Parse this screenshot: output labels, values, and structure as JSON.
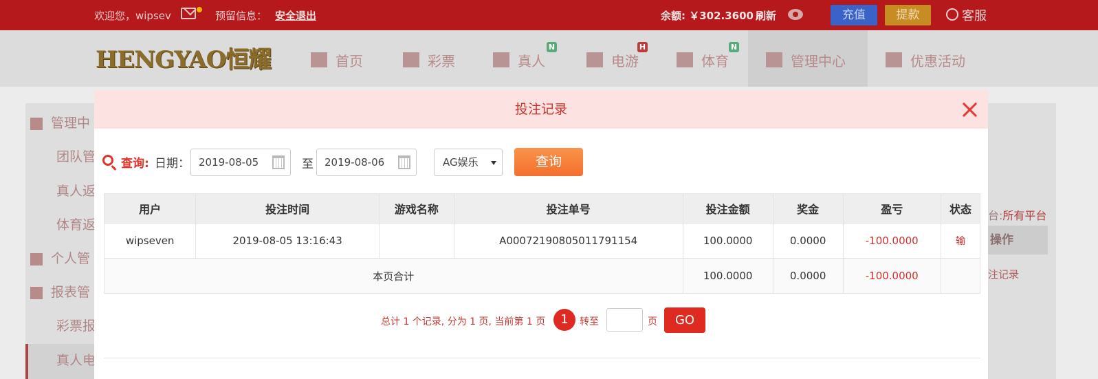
{
  "topbar": {
    "welcome": "欢迎您，wipsev",
    "reserve_info": "预留信息：",
    "logout": "安全退出",
    "balance": "余额: ￥302.3600",
    "refresh": "刷新",
    "recharge": "充值",
    "withdraw": "提款",
    "service": "客服"
  },
  "logo_text": "HENGYAO恒耀",
  "nav": {
    "items": [
      {
        "label": "首页",
        "icon": "home-icon"
      },
      {
        "label": "彩票",
        "icon": "ticket-icon"
      },
      {
        "label": "真人",
        "icon": "person-icon",
        "badge": "N"
      },
      {
        "label": "电游",
        "icon": "arcade-icon",
        "badge": "H"
      },
      {
        "label": "体育",
        "icon": "trophy-icon",
        "badge": "N"
      },
      {
        "label": "管理中心",
        "icon": "users-icon"
      },
      {
        "label": "优惠活动",
        "icon": "gift-icon"
      }
    ]
  },
  "sidebar": {
    "items": [
      "管理中",
      "团队管",
      "真人返",
      "体育返",
      "个人管",
      "报表管",
      "彩票报",
      "真人电"
    ]
  },
  "right_panel": {
    "platform_prefix": "台:",
    "platform_value": "所有平台",
    "header": "操作",
    "link": "注记录"
  },
  "modal": {
    "title": "投注记录",
    "query_label": "查询:",
    "date_label": "日期：",
    "date_from": "2019-08-05",
    "to_label": "至",
    "date_to": "2019-08-06",
    "platform_selected": "AG娱乐",
    "query_button": "查询",
    "table": {
      "headers": [
        "用户",
        "投注时间",
        "游戏名称",
        "投注单号",
        "投注金额",
        "奖金",
        "盈亏",
        "状态"
      ],
      "rows": [
        {
          "user": "wipseven",
          "time": "2019-08-05 13:16:43",
          "game": "",
          "order_no": "A00072190805011791154",
          "amount": "100.0000",
          "bonus": "0.0000",
          "profit": "-100.0000",
          "status": "输"
        }
      ],
      "total": {
        "label": "本页合计",
        "amount": "100.0000",
        "bonus": "0.0000",
        "profit": "-100.0000"
      }
    },
    "pager": {
      "info": "总计 1 个记录, 分为 1 页, 当前第 1 页",
      "current_page": "1",
      "goto_label": "转至",
      "page_label": "页",
      "go_button": "GO"
    }
  },
  "colors": {
    "topbar_bg": "#b5191c",
    "accent_red": "#e0342c",
    "modal_header_bg": "#fde2e2",
    "query_btn": "#f36f2d"
  }
}
